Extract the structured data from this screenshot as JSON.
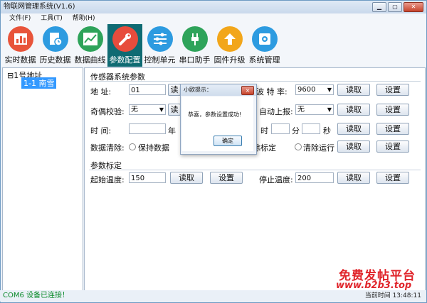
{
  "window": {
    "title": "物联网管理系统(V1.6)"
  },
  "menu": [
    "文件(F)",
    "工具(T)",
    "帮助(H)"
  ],
  "toolbar": [
    {
      "label": "实时数据",
      "icon": "bar-chart-icon",
      "color": "#e8543a"
    },
    {
      "label": "历史数据",
      "icon": "clock-document-icon",
      "color": "#2d9be0"
    },
    {
      "label": "数据曲线",
      "icon": "line-chart-icon",
      "color": "#2ea35a"
    },
    {
      "label": "参数配置",
      "icon": "wrench-icon",
      "color": "#e74c3c"
    },
    {
      "label": "控制单元",
      "icon": "sliders-icon",
      "color": "#2d9be0"
    },
    {
      "label": "串口助手",
      "icon": "plug-icon",
      "color": "#2ea35a"
    },
    {
      "label": "固件升级",
      "icon": "upload-arrow-icon",
      "color": "#f2a61a"
    },
    {
      "label": "系统管理",
      "icon": "gear-icon",
      "color": "#2d9be0"
    }
  ],
  "tree": {
    "root": "1号地址",
    "child": "1-1   南雪"
  },
  "sensor": {
    "heading": "传感器系统参数",
    "address_label": "地    址:",
    "address_value": "01",
    "baud_label": "波 特 率:",
    "baud_value": "9600",
    "parity_label": "奇偶校验:",
    "parity_value": "无",
    "auto_report_label": "自动上报:",
    "auto_report_value": "无",
    "time_label": "时    间:",
    "year_label": "年",
    "hour_label": "时",
    "minute_label": "分",
    "second_label": "秒",
    "clear_label": "数据清除:",
    "keep_label": "保持数据",
    "clear_cal_label": "除标定",
    "clear_run_label": "清除运行"
  },
  "calib": {
    "heading": "参数标定",
    "start_label": "起始温度:",
    "start_value": "150",
    "stop_label": "停止温度:",
    "stop_value": "200"
  },
  "buttons": {
    "read": "读取",
    "set": "设置"
  },
  "dialog": {
    "title": "小欧提示：",
    "message": "恭喜，参数设置成功!",
    "ok": "确定",
    "close": "×"
  },
  "status": {
    "left": "COM6 设备已连接！",
    "right": "当前时间 13:48:11"
  },
  "watermark": {
    "line1": "免费发帖平台",
    "line2": "www.b2b3.top"
  }
}
